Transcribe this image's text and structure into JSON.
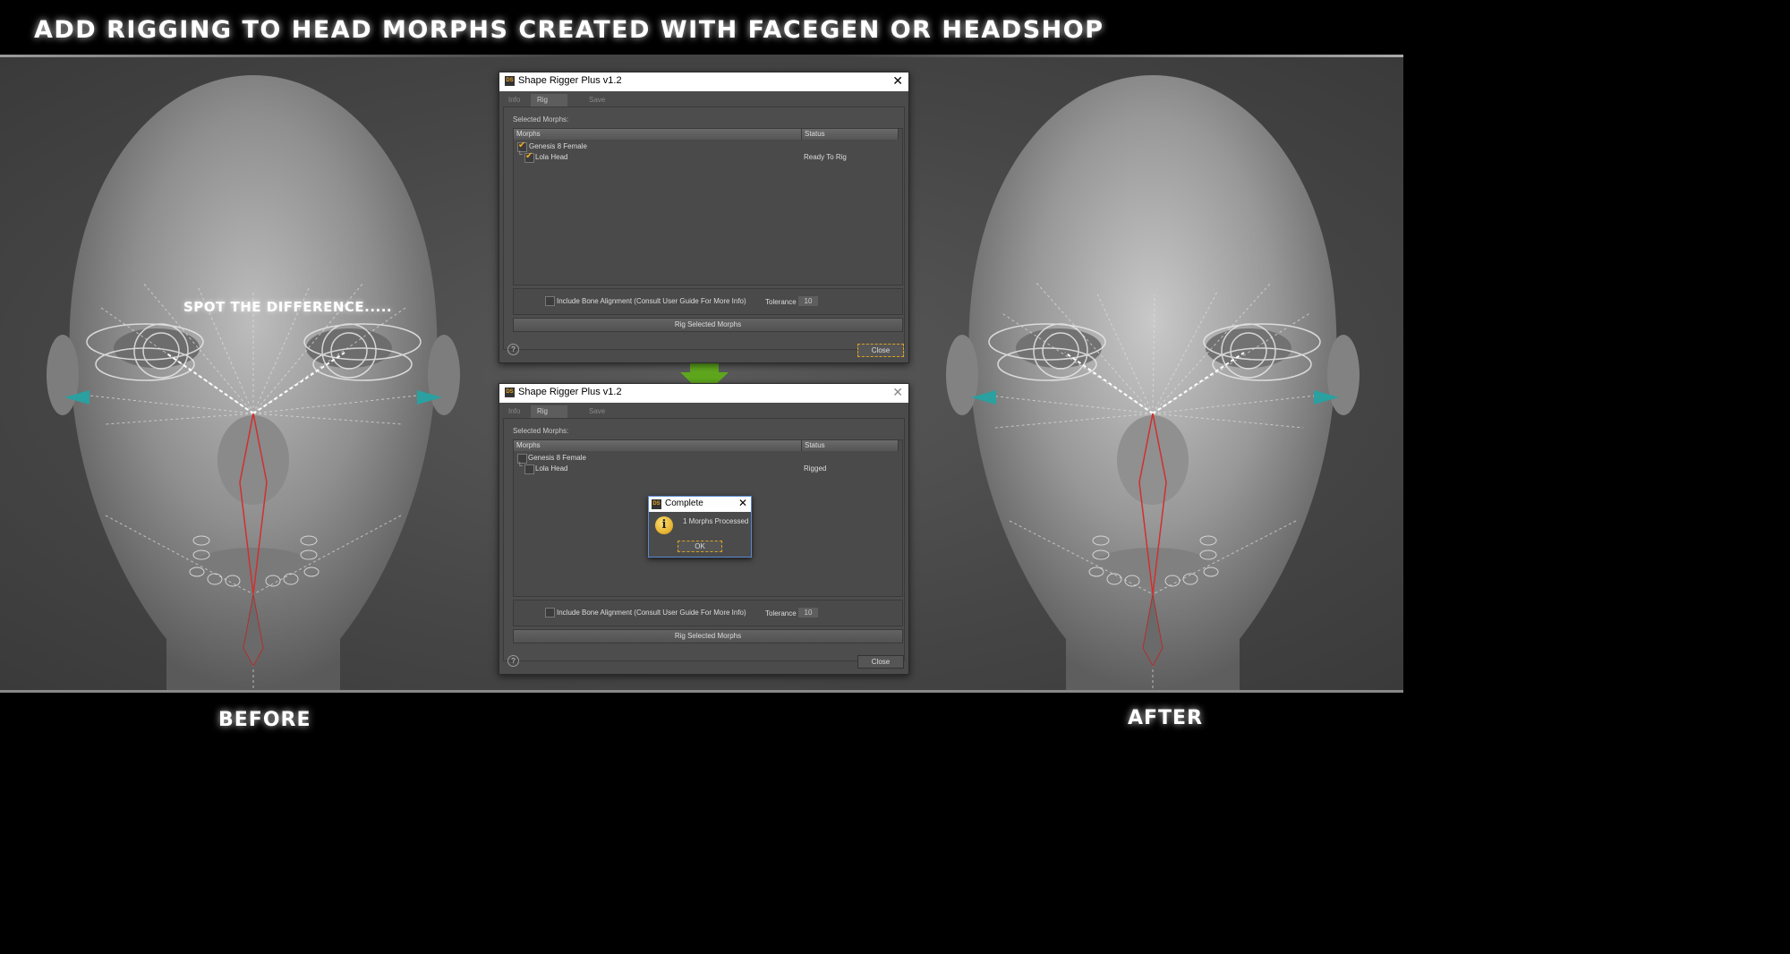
{
  "banner": {
    "title": "ADD RIGGING TO HEAD MORPHS CREATED WITH FACEGEN OR HEADSHOP"
  },
  "labels": {
    "before": "BEFORE",
    "after": "AFTER",
    "spot": "SPOT THE DIFFERENCE....."
  },
  "dialog_top": {
    "title": "Shape Rigger Plus v1.2",
    "tabs": [
      "Info",
      "Rig Morphs",
      "Save Morphs"
    ],
    "active_tab": "Rig Morphs",
    "selected_label": "Selected Morphs:",
    "columns": [
      "Morphs",
      "Status"
    ],
    "rows": [
      {
        "name": "Genesis 8 Female",
        "status": "",
        "checked": true
      },
      {
        "name": "Lola Head",
        "status": "Ready To Rig",
        "checked": true
      }
    ],
    "option_label": "Include Bone Alignment (Consult User Guide For More Info)",
    "tolerance_label": "Tolerance",
    "tolerance_value": "10",
    "rig_button": "Rig Selected Morphs",
    "help": "?",
    "close": "Close"
  },
  "dialog_bottom": {
    "title": "Shape Rigger Plus v1.2",
    "tabs": [
      "Info",
      "Rig Morphs",
      "Save Morphs"
    ],
    "active_tab": "Rig Morphs",
    "selected_label": "Selected Morphs:",
    "columns": [
      "Morphs",
      "Status"
    ],
    "rows": [
      {
        "name": "Genesis 8 Female",
        "status": "",
        "checked": false
      },
      {
        "name": "Lola Head",
        "status": "Rigged",
        "checked": false
      }
    ],
    "option_label": "Include Bone Alignment (Consult User Guide For More Info)",
    "tolerance_label": "Tolerance",
    "tolerance_value": "10",
    "rig_button": "Rig Selected Morphs",
    "help": "?",
    "close": "Close"
  },
  "popup": {
    "title": "Complete",
    "message": "1 Morphs Processed",
    "ok": "OK",
    "icon": "info-icon"
  },
  "colors": {
    "arrow": "#5fa81e",
    "accent": "#d9a323",
    "check": "#f0b020"
  },
  "icons": {
    "logo": "DS"
  }
}
